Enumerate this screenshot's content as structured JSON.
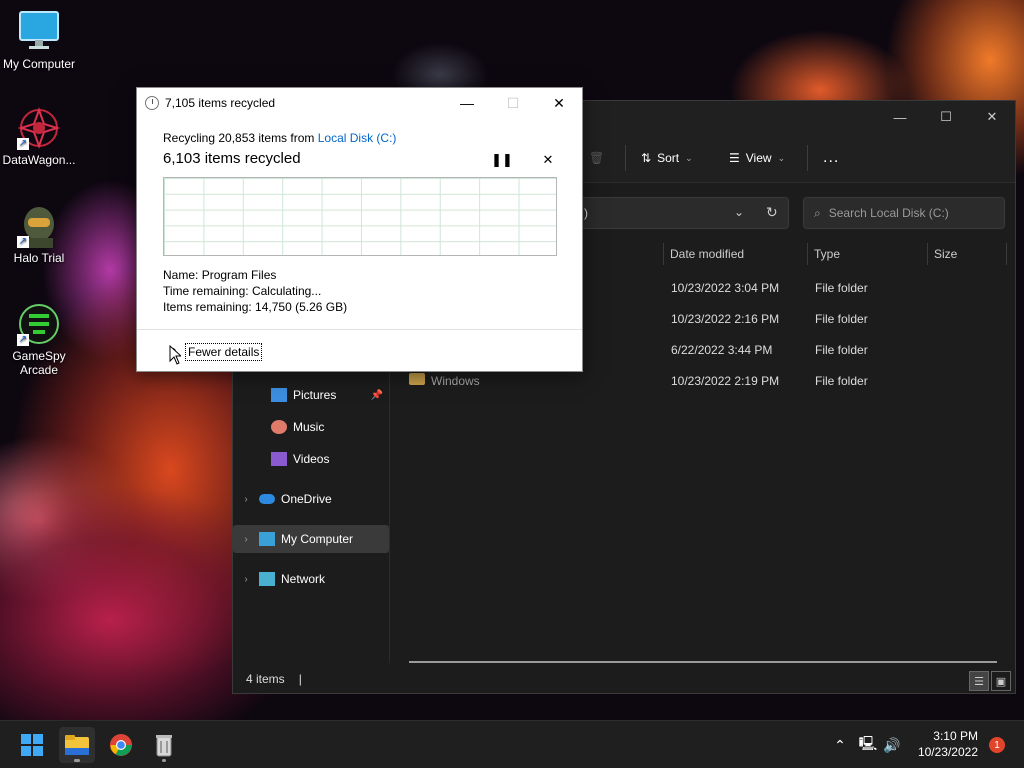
{
  "desktop": {
    "icons": [
      {
        "label": "My Computer",
        "icon": "monitor-icon"
      },
      {
        "label": "DataWagon...",
        "icon": "datawagon-icon"
      },
      {
        "label": "Halo Trial",
        "icon": "halo-icon"
      },
      {
        "label": "GameSpy Arcade",
        "icon": "gamespy-icon"
      }
    ]
  },
  "dialog": {
    "title": "7,105 items recycled",
    "line1_prefix": "Recycling 20,853 items from ",
    "line1_link": "Local Disk (C:)",
    "big_status": "6,103 items recycled",
    "name_label": "Name:",
    "name_value": "Program Files",
    "time_label": "Time remaining:",
    "time_value": "Calculating...",
    "items_label": "Items remaining:",
    "items_value": "14,750 (5.26 GB)",
    "fewer_details": "Fewer details"
  },
  "explorer": {
    "toolbar": {
      "sort": "Sort",
      "view": "View",
      "more": "..."
    },
    "address_tail": ")",
    "search_placeholder": "Search Local Disk (C:)",
    "columns": {
      "date": "Date modified",
      "type": "Type",
      "size": "Size"
    },
    "rows": [
      {
        "name": "",
        "date": "10/23/2022 3:04 PM",
        "type": "File folder"
      },
      {
        "name": "",
        "date": "10/23/2022 2:16 PM",
        "type": "File folder"
      },
      {
        "name": "",
        "date": "6/22/2022 3:44 PM",
        "type": "File folder"
      },
      {
        "name": "Windows",
        "date": "10/23/2022 2:19 PM",
        "type": "File folder"
      }
    ],
    "nav": {
      "pictures": "Pictures",
      "music": "Music",
      "videos": "Videos",
      "onedrive": "OneDrive",
      "my_computer": "My Computer",
      "network": "Network"
    },
    "status": "4 items",
    "status_sep": "|"
  },
  "taskbar": {
    "time": "3:10 PM",
    "date": "10/23/2022",
    "notification_count": "1"
  }
}
